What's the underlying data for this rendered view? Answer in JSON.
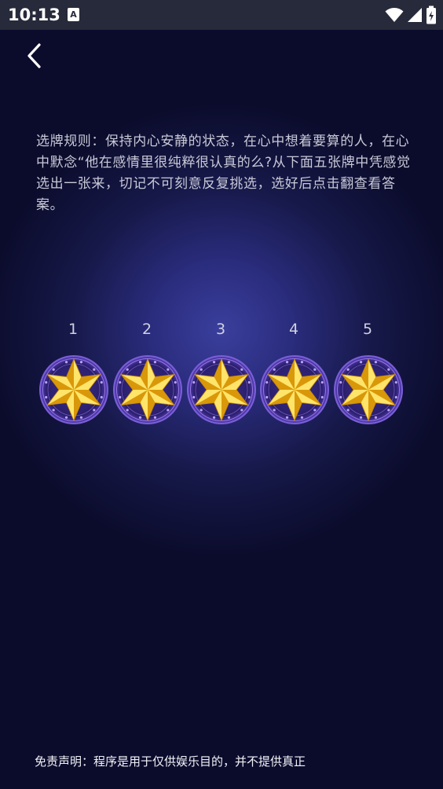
{
  "status_bar": {
    "time": "10:13",
    "app_icon_letter": "A"
  },
  "back_button": {
    "icon": "chevron-left-icon"
  },
  "rules_text": "选牌规则：保持内心安静的状态，在心中想着要算的人，在心中默念“他在感情里很纯粹很认真的么?从下面五张牌中凭感觉选出一张来，切记不可刻意反复挑选，选好后点击翻查看答案。",
  "cards": [
    {
      "number": "1"
    },
    {
      "number": "2"
    },
    {
      "number": "3"
    },
    {
      "number": "4"
    },
    {
      "number": "5"
    }
  ],
  "disclaimer": "免责声明：程序是用于仅供娱乐目的，并不提供真正",
  "colors": {
    "background": "#0b0c2c",
    "glow": "#3a3f9c",
    "star": "#f5c21a",
    "medal_ring": "#7a5fd6"
  }
}
